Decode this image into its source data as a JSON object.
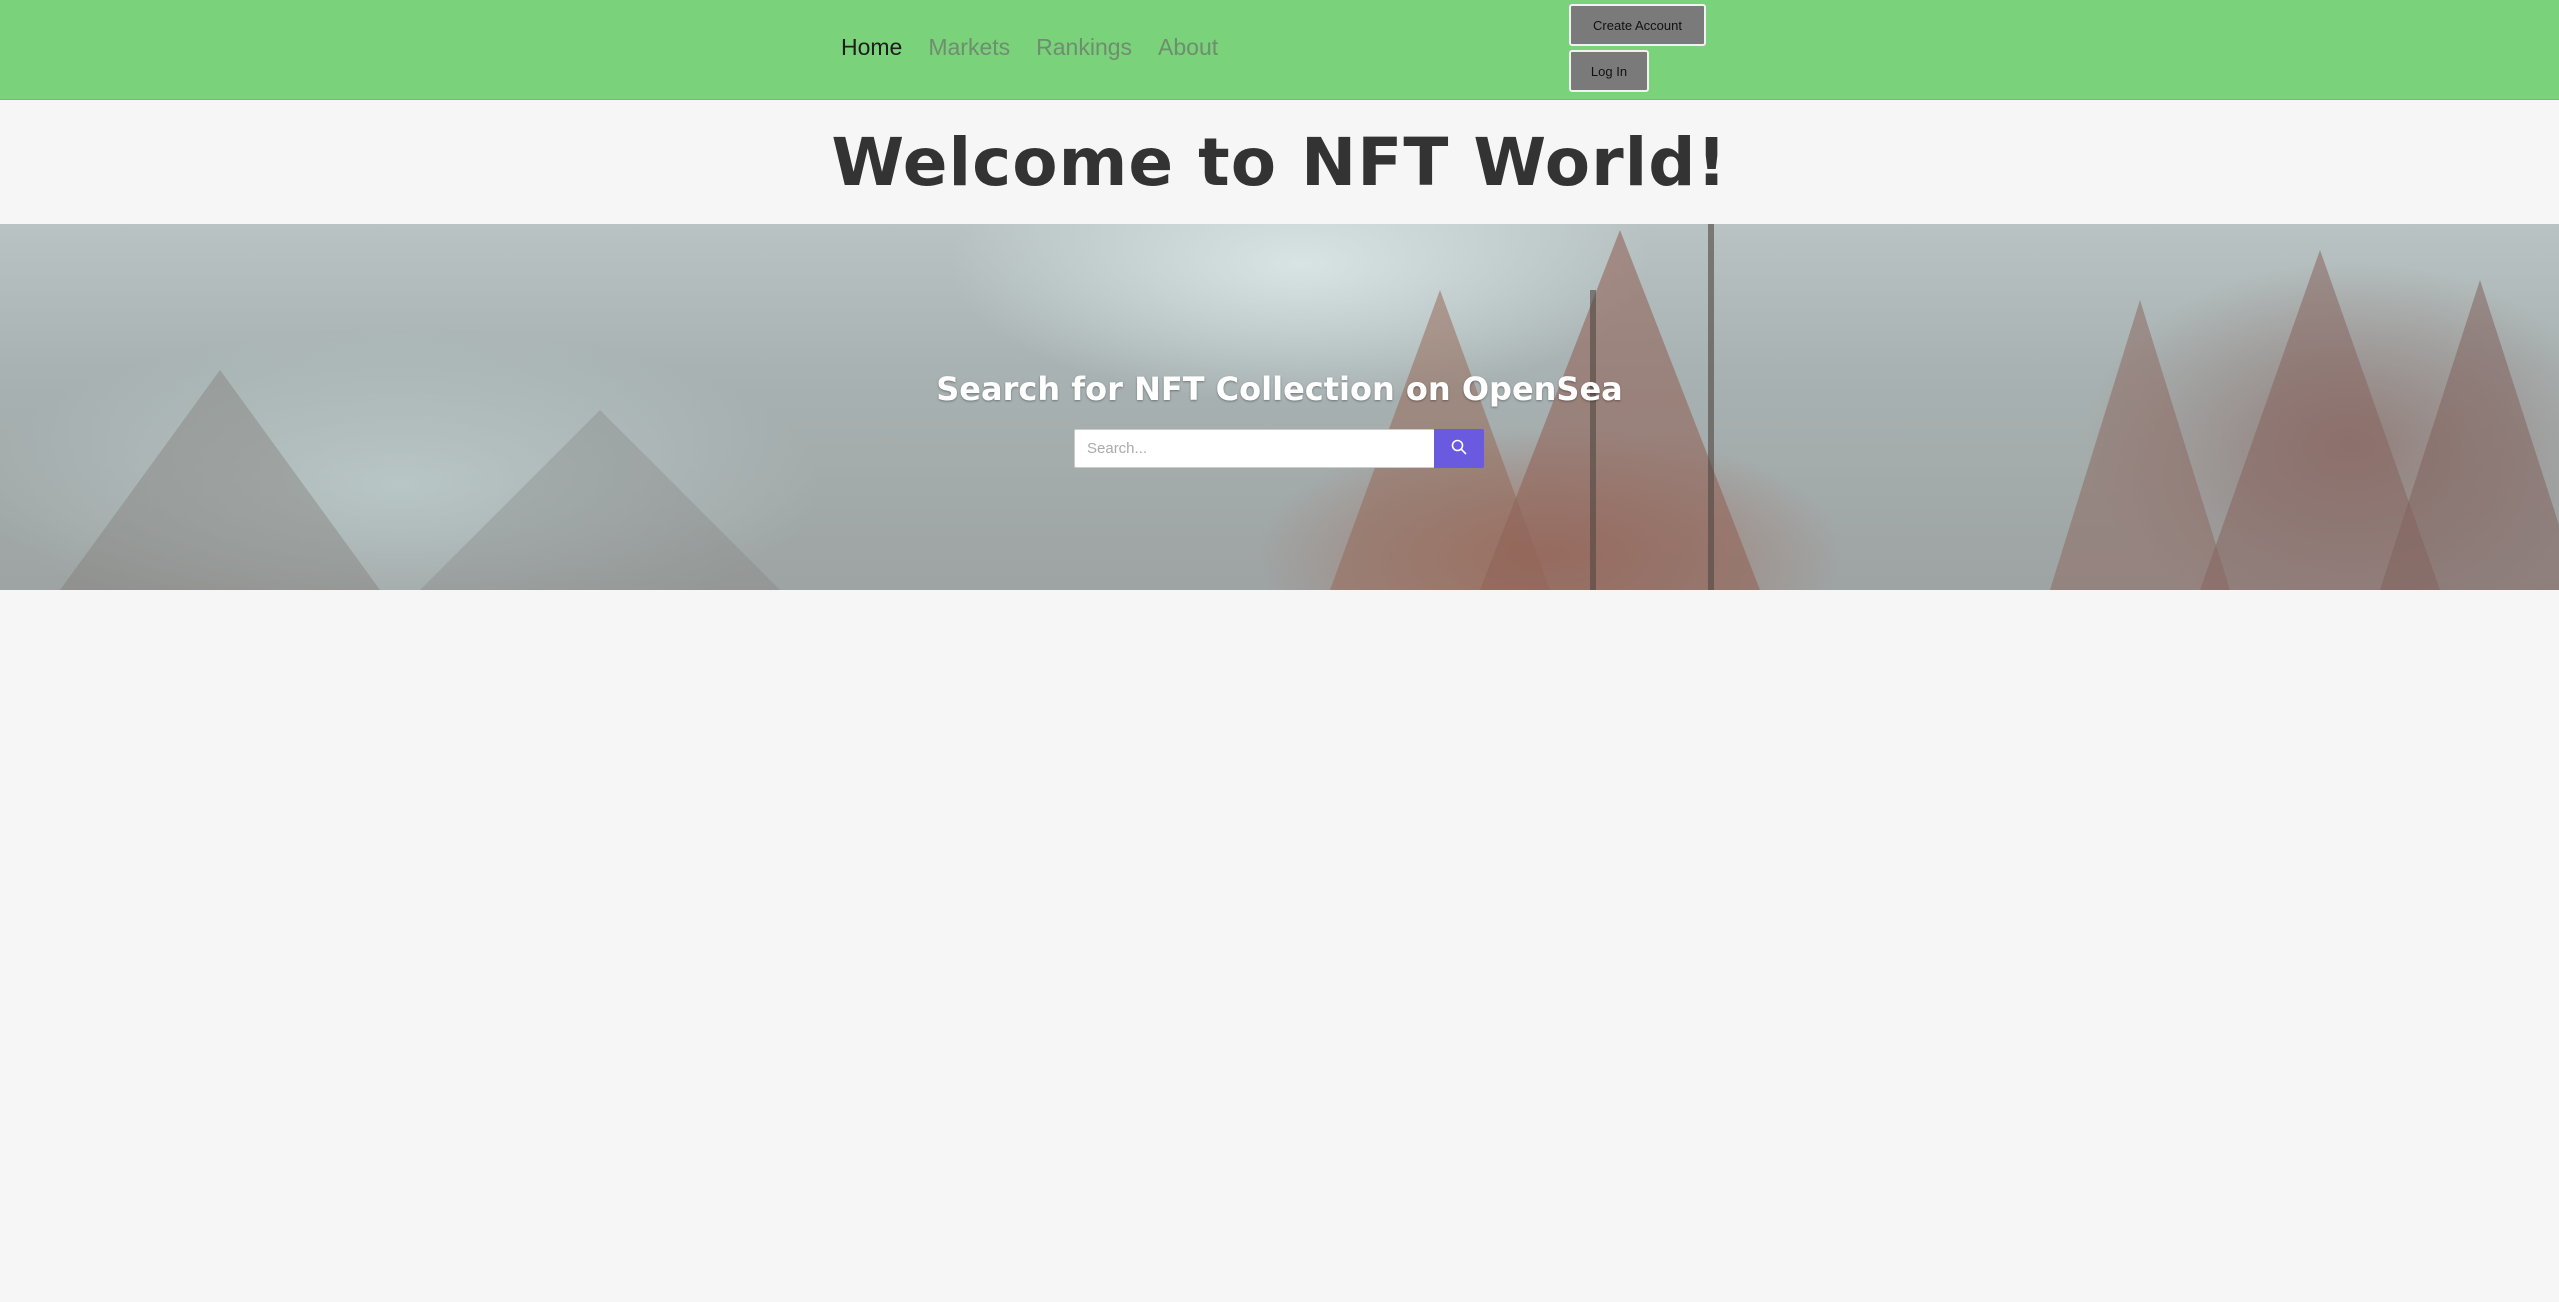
{
  "nav": {
    "items": [
      {
        "label": "Home",
        "active": true
      },
      {
        "label": "Markets",
        "active": false
      },
      {
        "label": "Rankings",
        "active": false
      },
      {
        "label": "About",
        "active": false
      }
    ]
  },
  "account": {
    "create_label": "Create Account",
    "login_label": "Log In"
  },
  "header": {
    "title": "Welcome to NFT World!"
  },
  "hero": {
    "title": "Search for NFT Collection on OpenSea",
    "search_placeholder": "Search...",
    "search_icon": "search-icon"
  },
  "colors": {
    "topbar": "#7ad27a",
    "search_button": "#6a5ae0",
    "page_background": "#f6f6f6"
  }
}
